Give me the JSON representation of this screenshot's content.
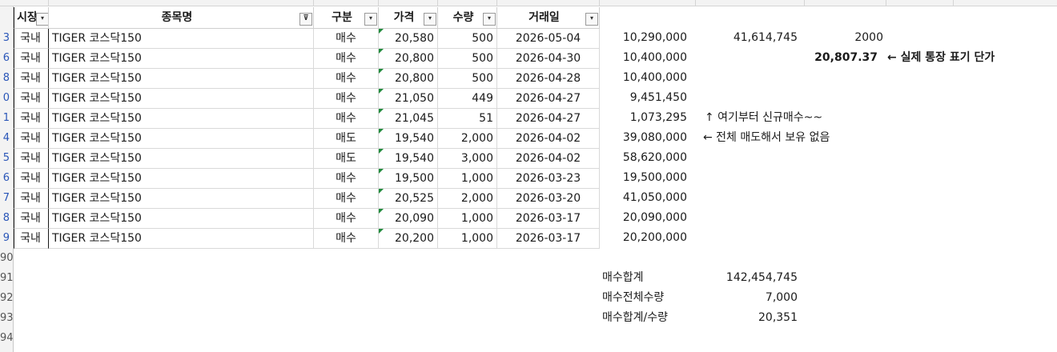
{
  "headers": {
    "col_a": "시장",
    "col_b": "종목명",
    "col_c": "구분",
    "col_d": "가격",
    "col_e": "수량",
    "col_f": "거래일"
  },
  "row_numbers": [
    "3",
    "6",
    "8",
    "0",
    "1",
    "4",
    "5",
    "6",
    "7",
    "8",
    "9",
    "90",
    "91",
    "92",
    "93",
    "94"
  ],
  "rows": [
    {
      "market": "국내",
      "name": "TIGER 코스닥150",
      "type": "매수",
      "price": "20,580",
      "qty": "500",
      "date": "2026-05-04",
      "amount": "10,290,000"
    },
    {
      "market": "국내",
      "name": "TIGER 코스닥150",
      "type": "매수",
      "price": "20,800",
      "qty": "500",
      "date": "2026-04-30",
      "amount": "10,400,000"
    },
    {
      "market": "국내",
      "name": "TIGER 코스닥150",
      "type": "매수",
      "price": "20,800",
      "qty": "500",
      "date": "2026-04-28",
      "amount": "10,400,000"
    },
    {
      "market": "국내",
      "name": "TIGER 코스닥150",
      "type": "매수",
      "price": "21,050",
      "qty": "449",
      "date": "2026-04-27",
      "amount": "9,451,450"
    },
    {
      "market": "국내",
      "name": "TIGER 코스닥150",
      "type": "매수",
      "price": "21,045",
      "qty": "51",
      "date": "2026-04-27",
      "amount": "1,073,295"
    },
    {
      "market": "국내",
      "name": "TIGER 코스닥150",
      "type": "매도",
      "price": "19,540",
      "qty": "2,000",
      "date": "2026-04-02",
      "amount": "39,080,000"
    },
    {
      "market": "국내",
      "name": "TIGER 코스닥150",
      "type": "매도",
      "price": "19,540",
      "qty": "3,000",
      "date": "2026-04-02",
      "amount": "58,620,000"
    },
    {
      "market": "국내",
      "name": "TIGER 코스닥150",
      "type": "매수",
      "price": "19,500",
      "qty": "1,000",
      "date": "2026-03-23",
      "amount": "19,500,000"
    },
    {
      "market": "국내",
      "name": "TIGER 코스닥150",
      "type": "매수",
      "price": "20,525",
      "qty": "2,000",
      "date": "2026-03-20",
      "amount": "41,050,000"
    },
    {
      "market": "국내",
      "name": "TIGER 코스닥150",
      "type": "매수",
      "price": "20,090",
      "qty": "1,000",
      "date": "2026-03-17",
      "amount": "20,090,000"
    },
    {
      "market": "국내",
      "name": "TIGER 코스닥150",
      "type": "매수",
      "price": "20,200",
      "qty": "1,000",
      "date": "2026-03-17",
      "amount": "20,200,000"
    }
  ],
  "side": {
    "total_value": "41,614,745",
    "total_qty": "2000",
    "avg_price": "20,807.37",
    "avg_note": "← 실제 통장 표기 단가",
    "new_buy_note": "↑ 여기부터 신규매수~~",
    "sold_note": "← 전체 매도해서 보유 없음"
  },
  "summary": {
    "buy_sum_label": "매수합계",
    "buy_sum_value": "142,454,745",
    "buy_qty_label": "매수전체수량",
    "buy_qty_value": "7,000",
    "avg_label": "매수합계/수량",
    "avg_value": "20,351"
  }
}
